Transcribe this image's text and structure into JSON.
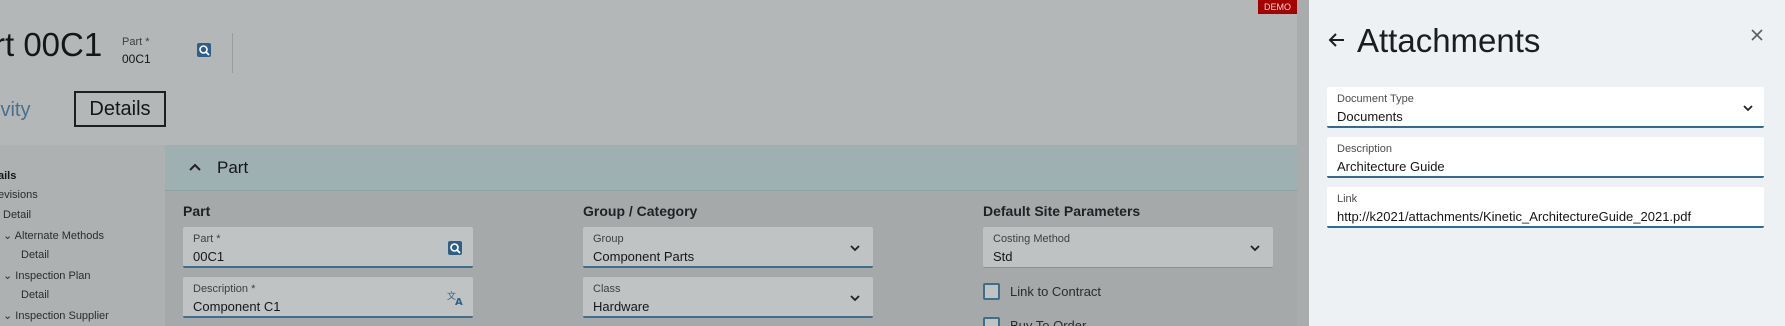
{
  "header": {
    "title": "rt 00C1",
    "part_label": "Part *",
    "part_value": "00C1",
    "tabs": [
      "ivity",
      "Details"
    ]
  },
  "demo_badge": "DEMO",
  "tree": {
    "items": [
      "ails",
      "evisions",
      "Detail",
      "Alternate Methods",
      "Detail",
      "Inspection Plan",
      "Detail",
      "Inspection Supplier"
    ]
  },
  "section": {
    "title": "Part",
    "columns": {
      "part": {
        "title": "Part",
        "fields": [
          {
            "label": "Part *",
            "value": "00C1"
          },
          {
            "label": "Description *",
            "value": "Component C1"
          }
        ]
      },
      "group": {
        "title": "Group / Category",
        "fields": [
          {
            "label": "Group",
            "value": "Component Parts"
          },
          {
            "label": "Class",
            "value": "Hardware"
          }
        ]
      },
      "site": {
        "title": "Default Site Parameters",
        "fields": [
          {
            "label": "Costing Method",
            "value": "Std"
          }
        ],
        "checkboxes": [
          "Link to Contract",
          "Buy To Order"
        ]
      }
    }
  },
  "panel": {
    "title": "Attachments",
    "fields": [
      {
        "label": "Document Type",
        "value": "Documents"
      },
      {
        "label": "Description",
        "value": "Architecture Guide"
      },
      {
        "label": "Link",
        "value": "http://k2021/attachments/Kinetic_ArchitectureGuide_2021.pdf"
      }
    ]
  },
  "colors": {
    "accent": "#2f6c91",
    "demo": "#a30000",
    "panel_bg": "#eef1f3"
  },
  "icons": [
    "search-icon",
    "translate-icon",
    "chevron-down-icon",
    "chevron-up-icon",
    "arrow-left-icon",
    "close-icon"
  ]
}
